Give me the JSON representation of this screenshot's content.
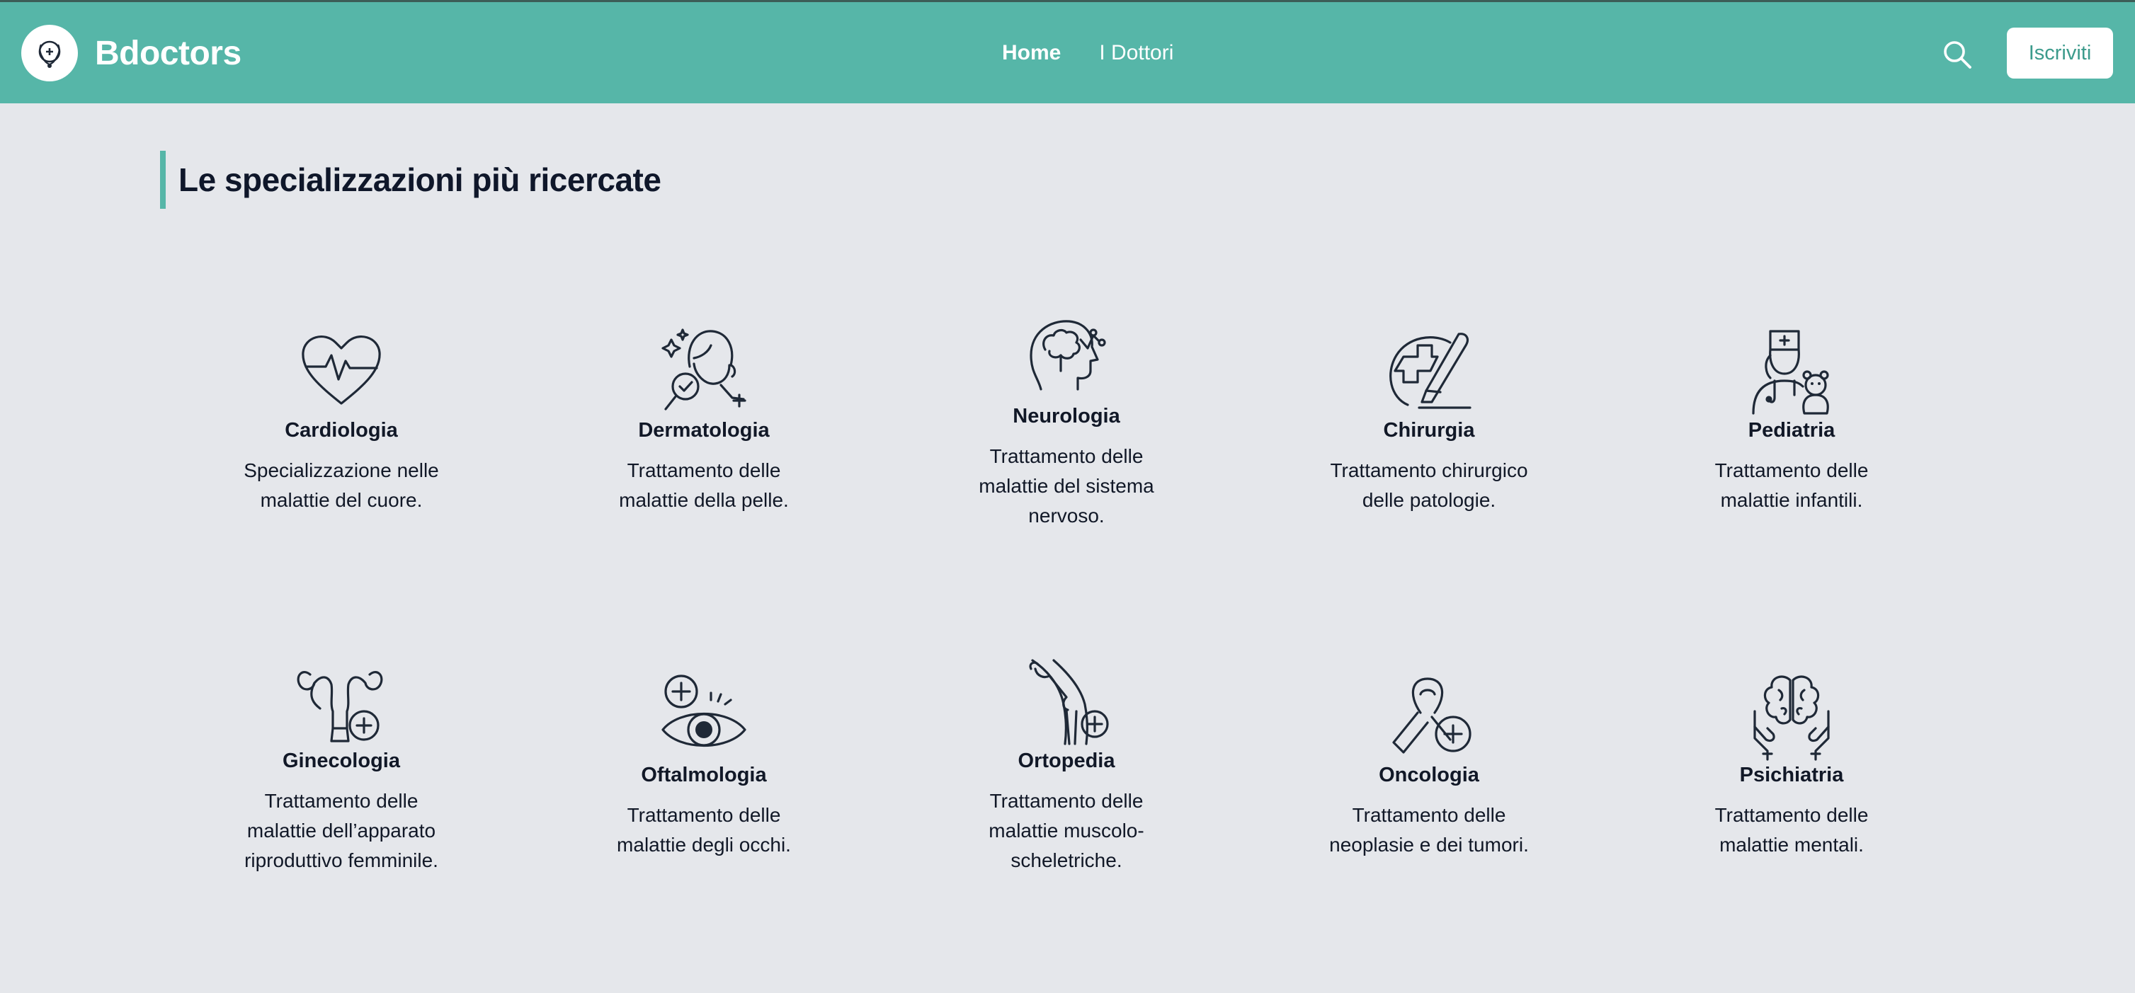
{
  "header": {
    "brand": "Bdoctors",
    "nav": [
      {
        "label": "Home"
      },
      {
        "label": "I Dottori"
      }
    ],
    "signup_label": "Iscriviti"
  },
  "colors": {
    "header_bg": "#56b6a8",
    "page_bg": "#e5e7eb",
    "accent": "#56b6a8"
  },
  "section": {
    "title": "Le specializzazioni più ricercate"
  },
  "specializations": [
    {
      "name": "Cardiologia",
      "desc": "Specializzazione nelle malattie del cuore.",
      "icon": "heart-pulse-icon"
    },
    {
      "name": "Dermatologia",
      "desc": "Trattamento delle malattie della pelle.",
      "icon": "skin-magnifier-icon"
    },
    {
      "name": "Neurologia",
      "desc": "Trattamento delle malattie del sistema nervoso.",
      "icon": "brain-head-icon"
    },
    {
      "name": "Chirurgia",
      "desc": "Trattamento chirurgico delle patologie.",
      "icon": "scalpel-cross-icon"
    },
    {
      "name": "Pediatria",
      "desc": "Trattamento delle malattie infantili.",
      "icon": "nurse-teddy-icon"
    },
    {
      "name": "Ginecologia",
      "desc": "Trattamento delle malattie dell’apparato riproduttivo femminile.",
      "icon": "uterus-icon"
    },
    {
      "name": "Oftalmologia",
      "desc": "Trattamento delle malattie degli occhi.",
      "icon": "eye-plus-icon"
    },
    {
      "name": "Ortopedia",
      "desc": "Trattamento delle malattie muscolo-scheletriche.",
      "icon": "knee-bone-icon"
    },
    {
      "name": "Oncologia",
      "desc": "Trattamento delle neoplasie e dei tumori.",
      "icon": "ribbon-plus-icon"
    },
    {
      "name": "Psichiatria",
      "desc": "Trattamento delle malattie mentali.",
      "icon": "brain-hands-icon"
    }
  ]
}
